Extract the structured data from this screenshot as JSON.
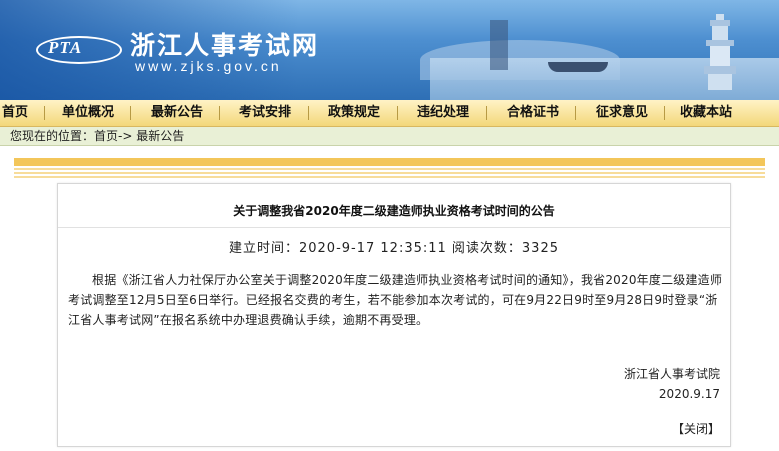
{
  "header": {
    "logo_text": "PTA",
    "site_title": "浙江人事考试网",
    "site_url": "www.zjks.gov.cn"
  },
  "nav": {
    "items": [
      "首页",
      "单位概况",
      "最新公告",
      "考试安排",
      "政策规定",
      "违纪处理",
      "合格证书",
      "征求意见",
      "收藏本站"
    ]
  },
  "breadcrumb": {
    "text": "您现在的位置：首页-> 最新公告"
  },
  "article": {
    "title": "关于调整我省2020年度二级建造师执业资格考试时间的公告",
    "meta": "建立时间：2020-9-17 12:35:11 阅读次数：3325",
    "body": "根据《浙江省人力社保厅办公室关于调整2020年度二级建造师执业资格考试时间的通知》，我省2020年度二级建造师考试调整至12月5日至6日举行。已经报名交费的考生，若不能参加本次考试的，可在9月22日9时至9月28日9时登录“浙江省人事考试网”在报名系统中办理退费确认手续，逾期不再受理。",
    "org": "浙江省人事考试院",
    "date": "2020.9.17",
    "close_label": "【关闭】"
  },
  "colors": {
    "banner": "#3a7cc2",
    "nav_bg": "#f6e19a",
    "crumb_bg": "#e9f0d6",
    "stripe": "#f3c65a"
  }
}
